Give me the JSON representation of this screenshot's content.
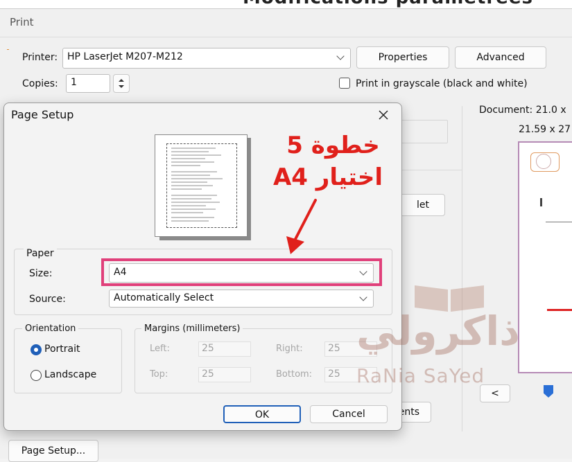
{
  "top_strip": {
    "text": "Modifications paramétrées"
  },
  "print_dialog": {
    "title": "Print",
    "printer_label": "Printer:",
    "printer_value": "HP LaserJet M207-M212",
    "properties_label": "Properties",
    "advanced_label": "Advanced",
    "copies_label": "Copies:",
    "copies_value": "1",
    "grayscale_label": "Print in grayscale (black and white)",
    "document_label": "Document: 21.0 x",
    "doc_size": "21.59 x 27",
    "behind_button_1": "let",
    "behind_button_2": "ents",
    "nav_prev": "<",
    "page_setup_label": "Page Setup..."
  },
  "page_setup": {
    "title": "Page Setup",
    "paper_group": "Paper",
    "size_label": "Size:",
    "size_value": "A4",
    "source_label": "Source:",
    "source_value": "Automatically Select",
    "orientation_group": "Orientation",
    "portrait_label": "Portrait",
    "landscape_label": "Landscape",
    "orientation_selected": "Portrait",
    "margins_group": "Margins (millimeters)",
    "left_label": "Left:",
    "left_value": "25",
    "right_label": "Right:",
    "right_value": "25",
    "top_label": "Top:",
    "top_value": "25",
    "bottom_label": "Bottom:",
    "bottom_value": "25",
    "ok_label": "OK",
    "cancel_label": "Cancel"
  },
  "annotation": {
    "line1": "خطوة 5",
    "line2": "اختيار A4",
    "color": "#e0201b",
    "highlight_color": "#e0407a"
  },
  "watermark": {
    "arabic": "ذاكرولي",
    "latin": "RaNia SaYed"
  },
  "colors": {
    "accent": "#1f5fb8",
    "dialog_bg": "#f3f3f3"
  }
}
